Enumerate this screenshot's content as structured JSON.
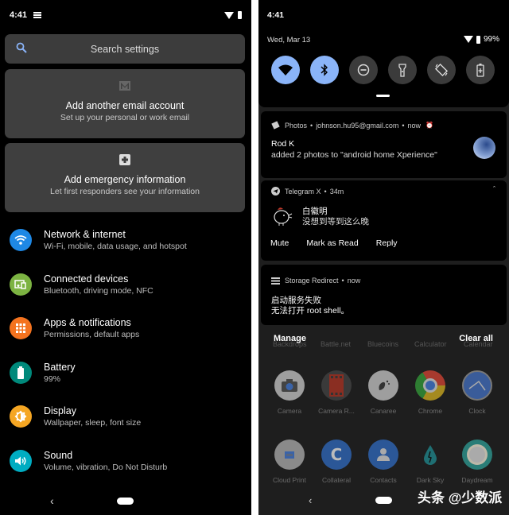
{
  "left": {
    "status_bar": {
      "time": "4:41"
    },
    "search": {
      "placeholder": "Search settings"
    },
    "suggestions": [
      {
        "icon": "gmail-icon",
        "title": "Add another email account",
        "subtitle": "Set up your personal or work email"
      },
      {
        "icon": "medical-cross-icon",
        "title": "Add emergency information",
        "subtitle": "Let first responders see your information"
      }
    ],
    "settings": [
      {
        "icon": "wifi-icon",
        "color": "#1e88e5",
        "title": "Network & internet",
        "subtitle": "Wi-Fi, mobile, data usage, and hotspot"
      },
      {
        "icon": "connected-devices-icon",
        "color": "#7cb342",
        "title": "Connected devices",
        "subtitle": "Bluetooth, driving mode, NFC"
      },
      {
        "icon": "apps-grid-icon",
        "color": "#f4731f",
        "title": "Apps & notifications",
        "subtitle": "Permissions, default apps"
      },
      {
        "icon": "battery-icon",
        "color": "#00897b",
        "title": "Battery",
        "subtitle": "99%"
      },
      {
        "icon": "brightness-icon",
        "color": "#f5a623",
        "title": "Display",
        "subtitle": "Wallpaper, sleep, font size"
      },
      {
        "icon": "volume-icon",
        "color": "#00acc1",
        "title": "Sound",
        "subtitle": "Volume, vibration, Do Not Disturb"
      }
    ]
  },
  "right": {
    "time": "4:41",
    "date": "Wed, Mar 13",
    "battery_pct": "99%",
    "tiles": [
      {
        "icon": "wifi-icon",
        "active": true
      },
      {
        "icon": "bluetooth-icon",
        "active": true
      },
      {
        "icon": "do-not-disturb-icon",
        "active": false
      },
      {
        "icon": "flashlight-icon",
        "active": false
      },
      {
        "icon": "auto-rotate-icon",
        "active": false
      },
      {
        "icon": "battery-saver-icon",
        "active": false
      }
    ],
    "notifications": [
      {
        "app": "Photos",
        "account": "johnson.hu95@gmail.com",
        "time": "now",
        "title": "Rod K",
        "text": "added 2 photos to \"android home Xperience\""
      },
      {
        "app": "Telegram X",
        "time": "34m",
        "title": "白徽明",
        "text": "没想到等到这么晚",
        "actions": [
          "Mute",
          "Mark as Read",
          "Reply"
        ]
      },
      {
        "app": "Storage Redirect",
        "time": "now",
        "title": "启动服务失败",
        "text": "无法打开 root shell。"
      }
    ],
    "manage_label": "Manage",
    "clear_all_label": "Clear all",
    "hidden_apps_row": [
      "Backdrops",
      "Battle.net",
      "Bluecoins",
      "Calculator",
      "Calendar"
    ],
    "apps_row1": [
      {
        "name": "Camera",
        "color": "#9e9e9e"
      },
      {
        "name": "Camera R...",
        "color": "#b23a2a"
      },
      {
        "name": "Canaree",
        "color": "#9e9e9e"
      },
      {
        "name": "Chrome",
        "color": "#4caf50"
      },
      {
        "name": "Clock",
        "color": "#3f6ab0"
      }
    ],
    "apps_row2": [
      {
        "name": "Cloud Print",
        "color": "#8a8a8a"
      },
      {
        "name": "Collateral",
        "color": "#2b5797"
      },
      {
        "name": "Contacts",
        "color": "#2b5797"
      },
      {
        "name": "Dark Sky",
        "color": "#1e1e1e"
      },
      {
        "name": "Daydream",
        "color": "#2a9d8f"
      }
    ],
    "watermark": "头条 @少数派"
  }
}
